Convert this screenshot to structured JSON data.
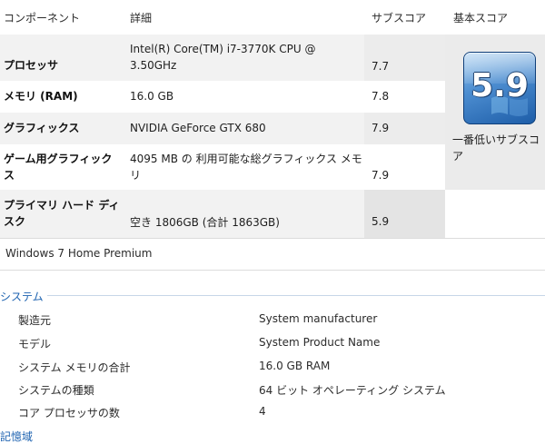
{
  "header": {
    "component": "コンポーネント",
    "detail": "詳細",
    "subscore": "サブスコア",
    "basescore": "基本スコア"
  },
  "rows": [
    {
      "component": "プロセッサ",
      "detail": "Intel(R) Core(TM) i7-3770K CPU @ 3.50GHz",
      "score": "7.7"
    },
    {
      "component": "メモリ (RAM)",
      "detail": "16.0 GB",
      "score": "7.8"
    },
    {
      "component": "グラフィックス",
      "detail": "NVIDIA GeForce GTX 680",
      "score": "7.9"
    },
    {
      "component": "ゲーム用グラフィックス",
      "detail": "4095 MB の 利用可能な総グラフィックス メモリ",
      "score": "7.9"
    },
    {
      "component": "プライマリ ハード ディスク",
      "detail": "空き 1806GB (合計 1863GB)",
      "score": "5.9"
    }
  ],
  "base": {
    "score": "5.9",
    "note": "一番低いサブスコア",
    "badge_icon": "windows-experience-index-badge-icon"
  },
  "edition": "Windows 7 Home Premium",
  "system": {
    "title": "システム",
    "items": [
      {
        "key": "製造元",
        "value": "System manufacturer"
      },
      {
        "key": "モデル",
        "value": "System Product Name"
      },
      {
        "key": "システム メモリの合計",
        "value": "16.0 GB RAM"
      },
      {
        "key": "システムの種類",
        "value": "64 ビット オペレーティング システム"
      },
      {
        "key": "コア プロセッサの数",
        "value": "4"
      }
    ]
  },
  "next_section": "記憶域",
  "colors": {
    "row_shaded": "#f2f2f2",
    "subscore_highlight": "#e6e6e6",
    "section_title": "#1d62b0"
  }
}
